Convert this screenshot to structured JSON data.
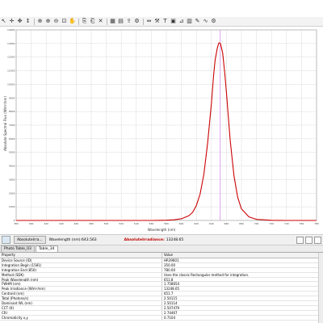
{
  "toolbar": {
    "buttons": [
      "pointer-icon",
      "crosshair-icon",
      "pan-icon",
      "vertical-cursor-icon",
      "zoom-in-icon",
      "zoom-in-plus-icon",
      "zoom-out-icon",
      "zoom-fit-icon",
      "hand-icon",
      "copy-icon",
      "paste-icon",
      "delete-icon",
      "chart-icon",
      "grid-icon",
      "export-icon",
      "settings-icon",
      "arrows-icon",
      "tool-icon",
      "text-icon",
      "image-icon",
      "ruler-icon",
      "table-icon",
      "draw-icon",
      "wave-icon",
      "gear-icon"
    ]
  },
  "chart_data": {
    "type": "line",
    "title": "",
    "xlabel": "Wavelength (nm)",
    "ylabel": "Absolute Spectral Flux (W/m²/nm)",
    "xlim": [
      380,
      780
    ],
    "ylim": [
      0,
      14000
    ],
    "grid": true,
    "marker_x": 651.8,
    "series": [
      {
        "color": "#cc0000",
        "x": [
          380,
          420,
          460,
          500,
          520,
          540,
          560,
          580,
          590,
          600,
          610,
          615,
          620,
          625,
          630,
          635,
          640,
          643,
          645,
          648,
          650,
          652,
          655,
          658,
          660,
          662,
          665,
          670,
          675,
          680,
          690,
          700,
          720,
          740,
          760,
          780
        ],
        "y": [
          0,
          0,
          0,
          0,
          0,
          0,
          0,
          20,
          50,
          120,
          350,
          600,
          1100,
          1950,
          3400,
          5700,
          8600,
          10700,
          11800,
          12700,
          13050,
          13000,
          12300,
          10700,
          9400,
          8000,
          5900,
          3300,
          1700,
          850,
          260,
          80,
          10,
          0,
          0,
          0
        ]
      }
    ]
  },
  "bottom_bar": {
    "mode": "AbsoluteIrra...",
    "wavelength": "Wavelength (nm):643.563",
    "abs_label": "AbsoluteIrradiance:",
    "abs_value": "13248.65"
  },
  "tabs": [
    "Photo Table_03",
    "Table_34"
  ],
  "table": {
    "headers": [
      "Property",
      "Value"
    ],
    "rows": [
      [
        "Device Source (ID)",
        "HR39601"
      ],
      [
        "Integration Begin (1581)",
        "350.00"
      ],
      [
        "Integration End (850)",
        "780.00"
      ],
      [
        "Method (SDK)",
        "Uses the classic Rectangular method for integration."
      ],
      [
        "Peak Wavelength (nm)",
        "651.8"
      ],
      [
        "FWHM (nm)",
        "1.758654"
      ],
      [
        "Peak Irradiance (W/m²/nm)",
        "13248.65"
      ],
      [
        "Centroid (nm)",
        "651.7"
      ],
      [
        "Total (Photons/s)",
        "2.50115"
      ],
      [
        "Dominant WL (nm)",
        "2.50114"
      ],
      [
        "CCT (K)",
        "2.507479"
      ],
      [
        "CRI",
        "2.74467"
      ],
      [
        "Chromaticity x,y",
        "0.7104"
      ]
    ]
  }
}
